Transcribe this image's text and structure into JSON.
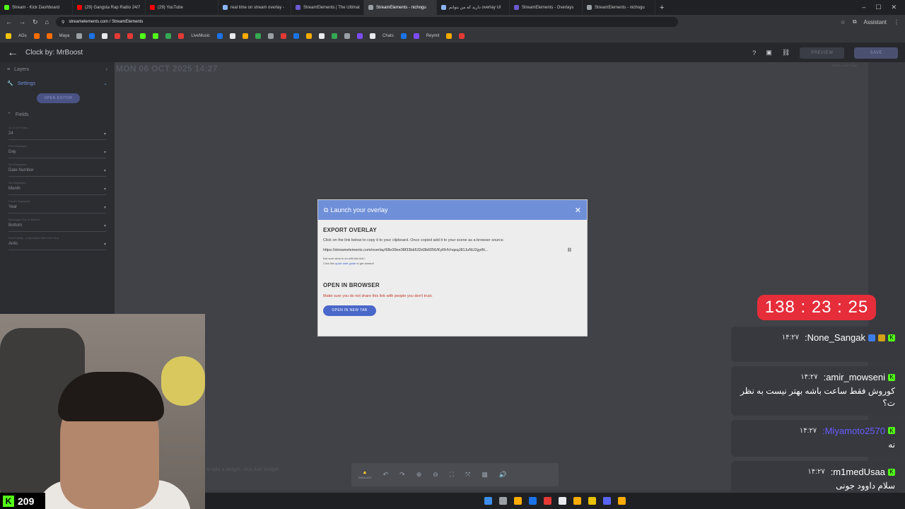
{
  "browser": {
    "tabs": [
      {
        "title": "Stream - Kick Dashboard",
        "color": "#53fc18",
        "active": false
      },
      {
        "title": "(29) Gangsta Rap Radio 24/7",
        "color": "#ff0000",
        "active": false
      },
      {
        "title": "(29) YouTube",
        "color": "#ff0000",
        "active": false
      },
      {
        "title": "real time on stream overlay -",
        "color": "#8ab4f8",
        "active": false
      },
      {
        "title": "StreamElements | The Ultimat",
        "color": "#6b5bd2",
        "active": false
      },
      {
        "title": "StreamElements - nichogu",
        "color": "#9aa0a6",
        "active": true
      },
      {
        "title": "دارید که من بتوانم overlay UI",
        "color": "#8ab4f8",
        "active": false
      },
      {
        "title": "StreamElements - Overlays",
        "color": "#6b5bd2",
        "active": false
      },
      {
        "title": "StreamElements - nichogu",
        "color": "#9aa0a6",
        "active": false
      }
    ],
    "url": "streamelements.com / StreamElements",
    "assistant_label": "Assistant",
    "bookmarks": [
      {
        "label": "AGs",
        "color": "#f1c40f"
      },
      {
        "label": "Maya",
        "color": "#ff6d00"
      },
      {
        "label": "LiveMusic",
        "color": "#e53935"
      },
      {
        "label": "Chats",
        "color": "#9aa0a6"
      },
      {
        "label": "Reymit",
        "color": "#7b4cff"
      }
    ]
  },
  "app": {
    "title": "Clock by: MrBoost",
    "preview_label": "PREVIEW",
    "save_label": "SAVE",
    "canvas_clock_text": "MON 06 OCT 2025 14:27",
    "dimensions_text": "1920px x 1077.24px"
  },
  "sidebar": {
    "layers_label": "Layers",
    "settings_label": "Settings",
    "open_editor_label": "OPEN EDITOR",
    "fields_label": "Fields",
    "fields": [
      {
        "label": "12 or 24 Hours",
        "value": "24"
      },
      {
        "label": "First Displayed",
        "value": "Day"
      },
      {
        "label": "2nd Displayed",
        "value": "Date Number"
      },
      {
        "label": "3rd Displayed",
        "value": "Month"
      },
      {
        "label": "Fourth Displayed",
        "value": "Year"
      },
      {
        "label": "Messages Top or Bottom",
        "value": "Bottom"
      },
      {
        "label": "Font Family - A Specified Web Font Stra",
        "value": "Antic"
      }
    ]
  },
  "modal": {
    "title": "Launch your overlay",
    "export_heading": "EXPORT OVERLAY",
    "export_desc": "Click on the link below to copy it to your clipboard. Once copied add it to your scene as a browser source.",
    "overlay_url": "https://streamelements.com/overlay/68e39ee38f33bb532d3b6056/KyRHVnqsqJ81JuNU2gytN...",
    "not_sure_text": "Not sure what to do with this link?",
    "guide_prefix": "Click this",
    "guide_link": "quick start guide",
    "guide_suffix": "to get started!",
    "browser_heading": "OPEN IN BROWSER",
    "warning": "Make sure you do not share this link with people you don't trust.",
    "open_tab_label": "OPEN IN NEW TAB"
  },
  "stream": {
    "viewer_count": "209",
    "timer": "138 : 23 : 25"
  },
  "chat": [
    {
      "time": "۱۴:۲۷",
      "user": ":None_Sangak",
      "user_color": "#ffffff",
      "text": ""
    },
    {
      "time": "۱۴:۲۷",
      "user": ":amir_mowseni",
      "user_color": "#ffffff",
      "text": "کوروش فقط ساعت باشه بهتر نیست به نظر ت؟"
    },
    {
      "time": "۱۴:۲۷",
      "user": ":Miyamoto2570",
      "user_color": "#6a5cff",
      "text": "نه"
    },
    {
      "time": "۱۴:۲۷",
      "user": ":m1medUsaa",
      "user_color": "#ffffff",
      "text": "سلام داوود جونی"
    }
  ],
  "toolbar": {
    "emulate_label": "EMULATE",
    "hint_text": "to add a widget, click Add Widget"
  }
}
